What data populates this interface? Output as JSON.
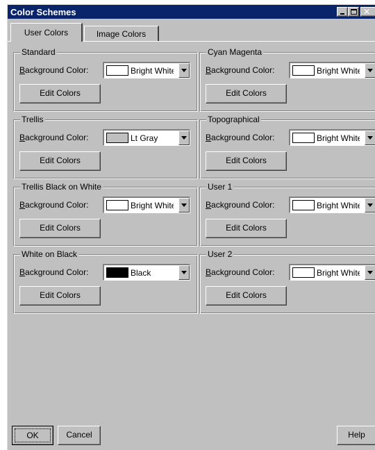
{
  "window": {
    "title": "Color Schemes",
    "controls": [
      "minimize-icon",
      "maximize-icon",
      "close-icon"
    ]
  },
  "tabs": [
    {
      "label": "User Colors",
      "active": true
    },
    {
      "label": "Image Colors",
      "active": false
    }
  ],
  "background_label": "Background Color:",
  "edit_label": "Edit Colors",
  "schemes": [
    {
      "title": "Standard",
      "bg_value": "Bright White",
      "swatch_color": "#ffffff"
    },
    {
      "title": "Cyan Magenta",
      "bg_value": "Bright White",
      "swatch_color": "#ffffff"
    },
    {
      "title": "Trellis",
      "bg_value": "Lt Gray",
      "swatch_color": "#c0c0c0"
    },
    {
      "title": "Topographical",
      "bg_value": "Bright White",
      "swatch_color": "#ffffff"
    },
    {
      "title": "Trellis Black on White",
      "bg_value": "Bright White",
      "swatch_color": "#ffffff"
    },
    {
      "title": "User 1",
      "bg_value": "Bright White",
      "swatch_color": "#ffffff"
    },
    {
      "title": "White on Black",
      "bg_value": "Black",
      "swatch_color": "#000000"
    },
    {
      "title": "User 2",
      "bg_value": "Bright White",
      "swatch_color": "#ffffff"
    }
  ],
  "buttons": {
    "ok": "OK",
    "cancel": "Cancel",
    "help": "Help"
  },
  "colors": {
    "title_bar": "#0a246a",
    "face": "#c0c0c0"
  }
}
